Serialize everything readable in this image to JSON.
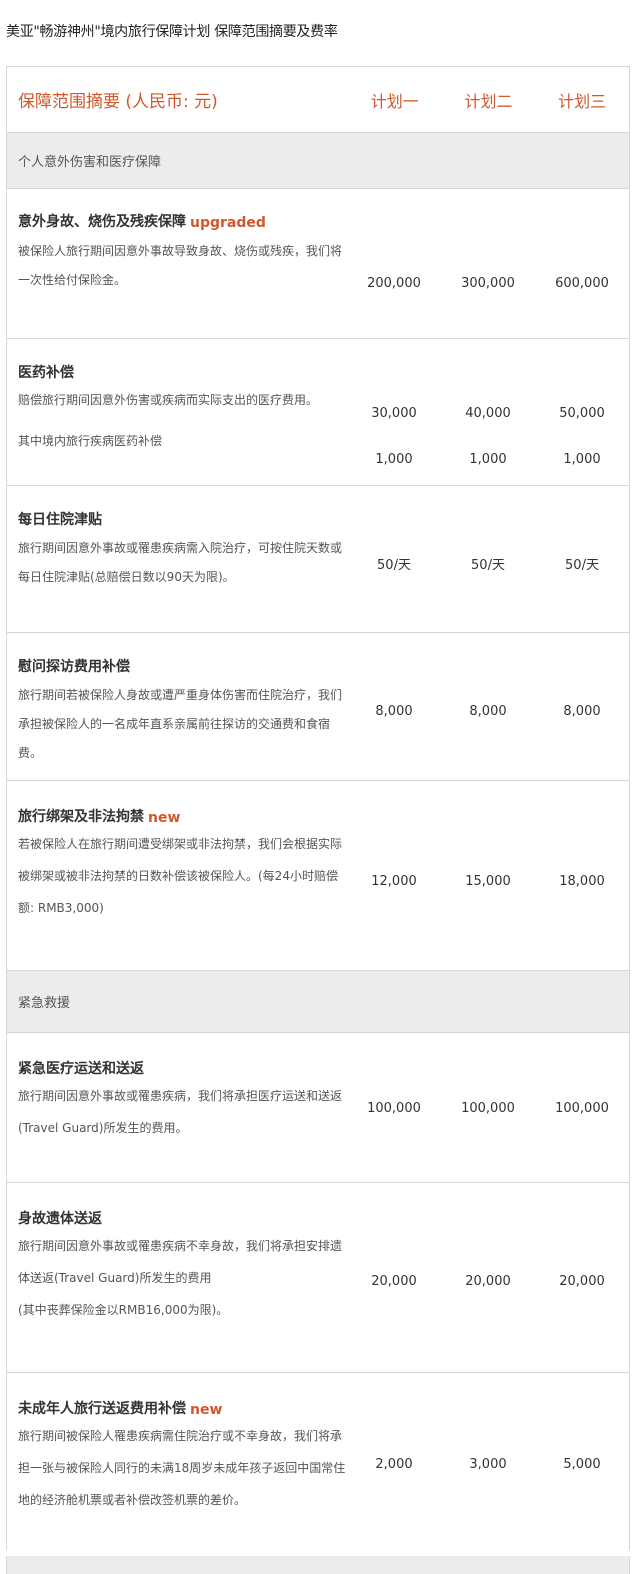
{
  "page_title": "美亚\"畅游神州\"境内旅行保障计划 保障范围摘要及费率",
  "table": {
    "header": {
      "desc": "保障范围摘要 (人民币: 元)",
      "plans": [
        "计划一",
        "计划二",
        "计划三"
      ]
    },
    "sections": [
      {
        "title": "个人意外伤害和医疗保障",
        "rows": [
          {
            "name": "意外身故、烧伤及残疾保障",
            "tag": "upgraded",
            "texts": [
              "被保险人旅行期间因意外事故导致身故、烧伤或残疾，我们将一次性给付保险金。"
            ],
            "values": [
              [
                "200,000",
                "300,000",
                "600,000"
              ]
            ]
          },
          {
            "name": "医药补偿",
            "tag": "",
            "texts": [
              "赔偿旅行期间因意外伤害或疾病而实际支出的医疗费用。",
              "其中境内旅行疾病医药补偿"
            ],
            "values": [
              [
                "30,000",
                "40,000",
                "50,000"
              ],
              [
                "1,000",
                "1,000",
                "1,000"
              ]
            ]
          },
          {
            "name": "每日住院津贴",
            "tag": "",
            "texts": [
              "旅行期间因意外事故或罹患疾病需入院治疗，可按住院天数或每日住院津贴(总赔偿日数以90天为限)。"
            ],
            "values": [
              [
                "50/天",
                "50/天",
                "50/天"
              ]
            ]
          },
          {
            "name": "慰问探访费用补偿",
            "tag": "",
            "texts": [
              "旅行期间若被保险人身故或遭严重身体伤害而住院治疗，我们承担被保险人的一名成年直系亲属前往探访的交通费和食宿费。"
            ],
            "values": [
              [
                "8,000",
                "8,000",
                "8,000"
              ]
            ]
          },
          {
            "name": "旅行绑架及非法拘禁",
            "tag": "new",
            "texts": [
              "若被保险人在旅行期间遭受绑架或非法拘禁，我们会根据实际被绑架或被非法拘禁的日数补偿该被保险人。(每24小时赔偿额: RMB3,000)"
            ],
            "values": [
              [
                "12,000",
                "15,000",
                "18,000"
              ]
            ]
          }
        ]
      },
      {
        "title": "紧急救援",
        "rows": [
          {
            "name": "紧急医疗运送和送返",
            "tag": "",
            "texts": [
              "旅行期间因意外事故或罹患疾病，我们将承担医疗运送和送返(Travel Guard)所发生的费用。"
            ],
            "values": [
              [
                "100,000",
                "100,000",
                "100,000"
              ]
            ]
          },
          {
            "name": "身故遗体送返",
            "tag": "",
            "texts": [
              "旅行期间因意外事故或罹患疾病不幸身故，我们将承担安排遗体送返(Travel Guard)所发生的费用",
              "(其中丧葬保险金以RMB16,000为限)。"
            ],
            "values": [
              [
                "20,000",
                "20,000",
                "20,000"
              ]
            ]
          },
          {
            "name": "未成年人旅行送返费用补偿",
            "tag": "new",
            "texts": [
              "旅行期间被保险人罹患疾病需住院治疗或不幸身故，我们将承担一张与被保险人同行的未满18周岁未成年孩子返回中国常住地的经济舱机票或者补偿改签机票的差价。"
            ],
            "values": [
              [
                "2,000",
                "3,000",
                "5,000"
              ]
            ]
          }
        ]
      }
    ]
  }
}
